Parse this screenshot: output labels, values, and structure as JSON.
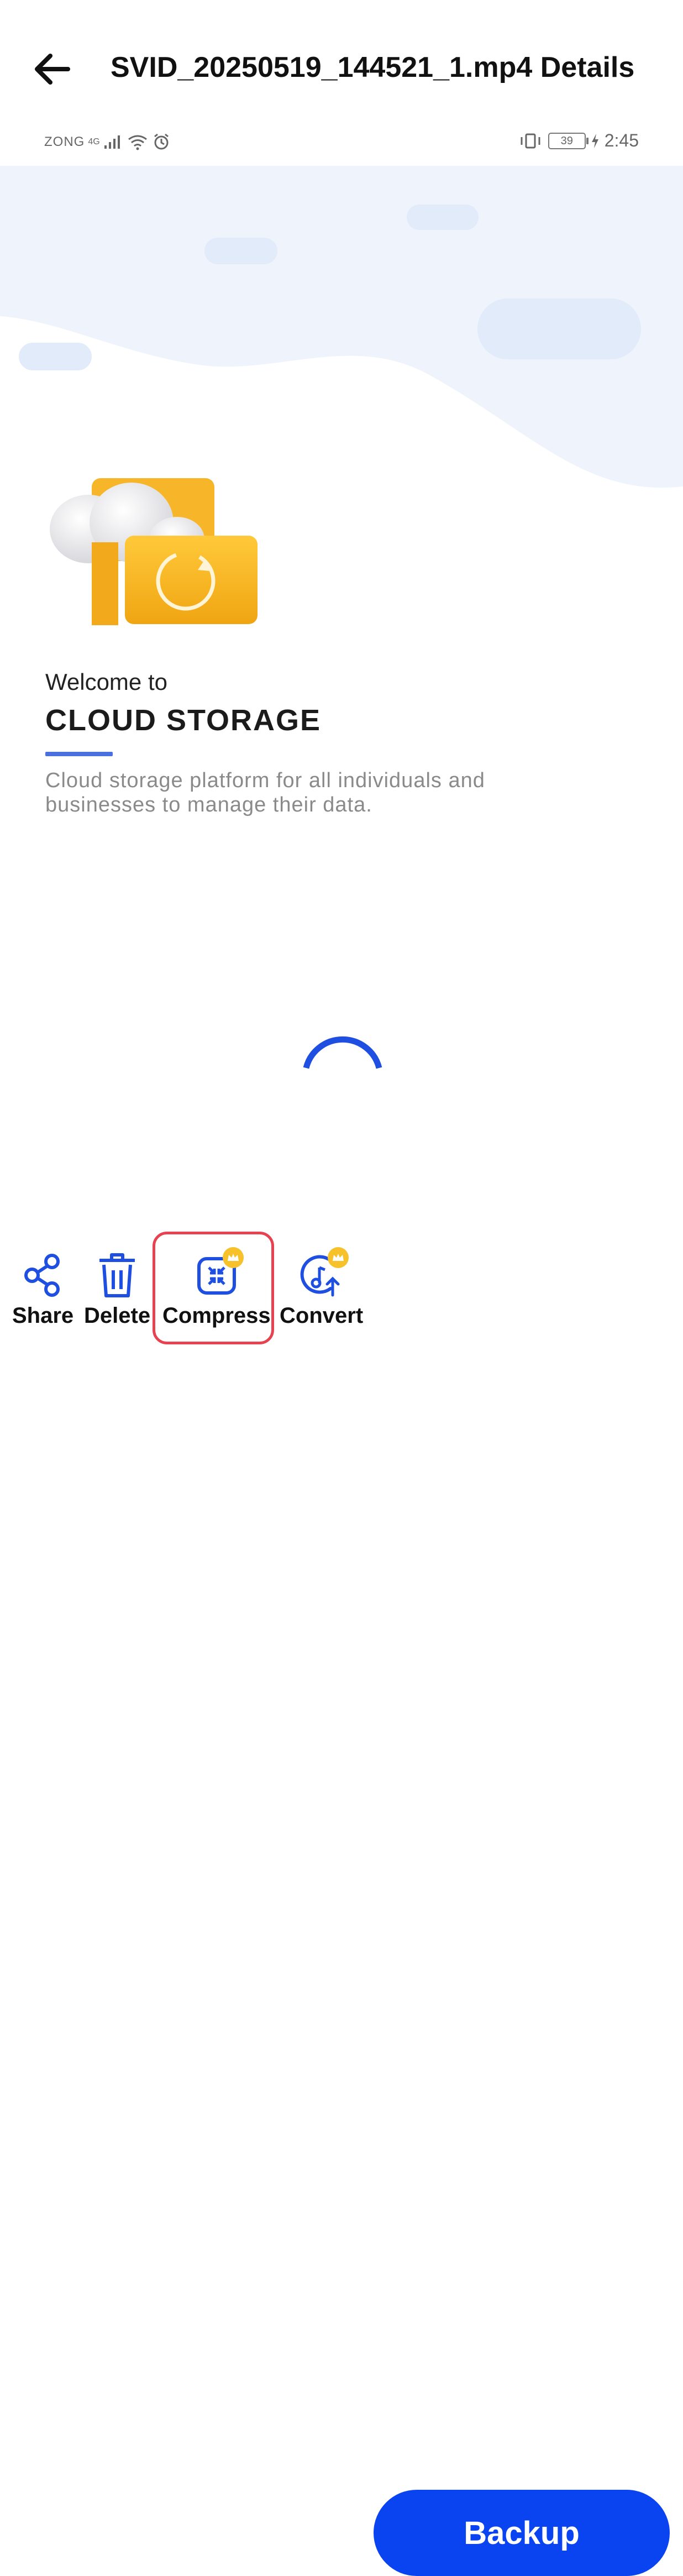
{
  "header": {
    "title": "SVID_20250519_144521_1.mp4 Details",
    "back_icon": "arrow-left-icon"
  },
  "status_bar": {
    "carrier": "ZONG",
    "network": "4G",
    "battery": "39",
    "time": "2:45"
  },
  "preview": {
    "welcome": "Welcome to",
    "brand": "CLOUD STORAGE",
    "description": "Cloud storage platform for all individuals and businesses to manage their data.",
    "accent_color": "#4a70e0"
  },
  "actions": [
    {
      "label": "Share",
      "icon": "share-icon"
    },
    {
      "label": "Delete",
      "icon": "trash-icon"
    },
    {
      "label": "Compress",
      "icon": "compress-icon",
      "premium": true
    },
    {
      "label": "Convert",
      "icon": "convert-audio-icon",
      "premium": true
    }
  ],
  "backup": {
    "label": "Backup",
    "color": "#0a43f0"
  },
  "highlight_color": "#e64250"
}
